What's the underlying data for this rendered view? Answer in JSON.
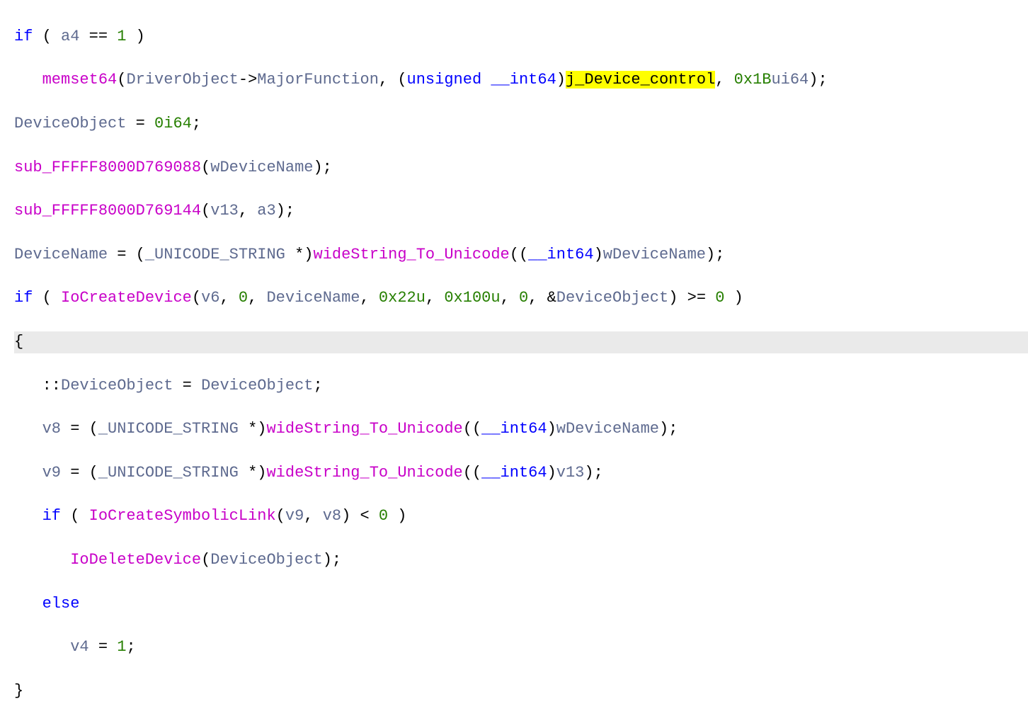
{
  "code": {
    "l1_if": "if",
    "l1_open": " ( ",
    "l1_var": "a4",
    "l1_eq": " == ",
    "l1_num": "1",
    "l1_close": " )",
    "l2_indent": "   ",
    "l2_func": "memset64",
    "l2_p1": "(",
    "l2_arg1": "DriverObject",
    "l2_arrow": "->",
    "l2_member": "MajorFunction",
    "l2_comma1": ", (",
    "l2_kw_unsigned": "unsigned",
    "l2_space": " ",
    "l2_kw_int64": "__int64",
    "l2_p2": ")",
    "l2_highlight": "j_Device_control",
    "l2_comma2": ", ",
    "l2_num": "0x1B",
    "l2_suffix": "ui64",
    "l2_end": ");",
    "l3_var": "DeviceObject",
    "l3_eq": " = ",
    "l3_num": "0i64",
    "l3_end": ";",
    "l4_func": "sub_FFFFF8000D769088",
    "l4_p1": "(",
    "l4_arg": "wDeviceName",
    "l4_p2": ");",
    "l5_func": "sub_FFFFF8000D769144",
    "l5_p1": "(",
    "l5_arg1": "v13",
    "l5_comma": ", ",
    "l5_arg2": "a3",
    "l5_p2": ");",
    "l6_var": "DeviceName",
    "l6_eq": " = (",
    "l6_type": "_UNICODE_STRING",
    "l6_star": " *)",
    "l6_func": "wideString_To_Unicode",
    "l6_p1": "((",
    "l6_kw_int64": "__int64",
    "l6_p2": ")",
    "l6_arg": "wDeviceName",
    "l6_end": ");",
    "l7_if": "if",
    "l7_open": " ( ",
    "l7_func": "IoCreateDevice",
    "l7_p1": "(",
    "l7_a1": "v6",
    "l7_c1": ", ",
    "l7_a2": "0",
    "l7_c2": ", ",
    "l7_a3": "DeviceName",
    "l7_c3": ", ",
    "l7_a4": "0x22u",
    "l7_c4": ", ",
    "l7_a5": "0x100u",
    "l7_c5": ", ",
    "l7_a6": "0",
    "l7_c6": ", &",
    "l7_a7": "DeviceObject",
    "l7_p2": ") >= ",
    "l7_zero": "0",
    "l7_close": " )",
    "l8_brace": "{",
    "l9_indent": "   ::",
    "l9_var1": "DeviceObject",
    "l9_eq": " = ",
    "l9_var2": "DeviceObject",
    "l9_end": ";",
    "l10_indent": "   ",
    "l10_var": "v8",
    "l10_eq": " = (",
    "l10_type": "_UNICODE_STRING",
    "l10_star": " *)",
    "l10_func": "wideString_To_Unicode",
    "l10_p1": "((",
    "l10_kw_int64": "__int64",
    "l10_p2": ")",
    "l10_arg": "wDeviceName",
    "l10_end": ");",
    "l11_indent": "   ",
    "l11_var": "v9",
    "l11_eq": " = (",
    "l11_type": "_UNICODE_STRING",
    "l11_star": " *)",
    "l11_func": "wideString_To_Unicode",
    "l11_p1": "((",
    "l11_kw_int64": "__int64",
    "l11_p2": ")",
    "l11_arg": "v13",
    "l11_end": ");",
    "l12_indent": "   ",
    "l12_if": "if",
    "l12_open": " ( ",
    "l12_func": "IoCreateSymbolicLink",
    "l12_p1": "(",
    "l12_a1": "v9",
    "l12_c1": ", ",
    "l12_a2": "v8",
    "l12_p2": ") < ",
    "l12_zero": "0",
    "l12_close": " )",
    "l13_indent": "      ",
    "l13_func": "IoDeleteDevice",
    "l13_p1": "(",
    "l13_arg": "DeviceObject",
    "l13_p2": ");",
    "l14_indent": "   ",
    "l14_else": "else",
    "l15_indent": "      ",
    "l15_var": "v4",
    "l15_eq": " = ",
    "l15_num": "1",
    "l15_end": ";",
    "l16_brace": "}"
  }
}
